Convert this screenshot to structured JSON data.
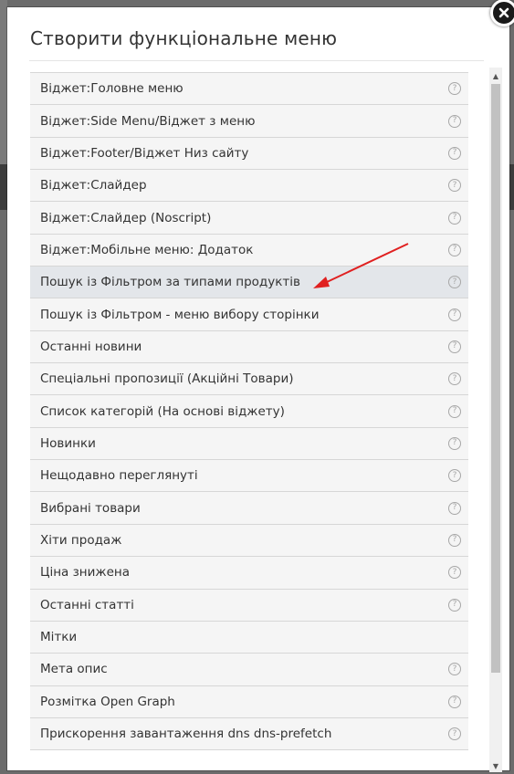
{
  "modal": {
    "title": "Створити функціональне меню"
  },
  "menu_items": [
    {
      "label": "Віджет:Головне меню",
      "help": "?"
    },
    {
      "label": "Віджет:Side Menu/Віджет з меню",
      "help": "?"
    },
    {
      "label": "Віджет:Footer/Віджет Низ сайту",
      "help": "?"
    },
    {
      "label": "Віджет:Слайдер",
      "help": "?"
    },
    {
      "label": "Віджет:Слайдер (Noscript)",
      "help": "?"
    },
    {
      "label": "Віджет:Мобільне меню: Додаток",
      "help": "?"
    },
    {
      "label": "Пошук із Фільтром за типами продуктів",
      "help": "?"
    },
    {
      "label": "Пошук із Фільтром - меню вибору сторінки",
      "help": "?"
    },
    {
      "label": "Останні новини",
      "help": "?"
    },
    {
      "label": "Спеціальні пропозиції (Акційні Товари)",
      "help": "?"
    },
    {
      "label": "Список категорій (На основі віджету)",
      "help": "?"
    },
    {
      "label": "Новинки",
      "help": "?"
    },
    {
      "label": "Нещодавно переглянуті",
      "help": "?"
    },
    {
      "label": "Вибрані товари",
      "help": "?"
    },
    {
      "label": "Хіти продаж",
      "help": "?"
    },
    {
      "label": "Ціна знижена",
      "help": "?"
    },
    {
      "label": "Останні статті",
      "help": "?"
    },
    {
      "label": "Мітки",
      "help": ""
    },
    {
      "label": "Мета опис",
      "help": "?"
    },
    {
      "label": "Розмітка Open Graph",
      "help": "?"
    },
    {
      "label": "Прискорення завантаження dns dns-prefetch",
      "help": "?"
    }
  ],
  "active_item_index": 6,
  "colors": {
    "annotation_arrow": "#e02020",
    "row_bg": "#f5f5f5",
    "active_row_bg": "#e3e6ea"
  }
}
